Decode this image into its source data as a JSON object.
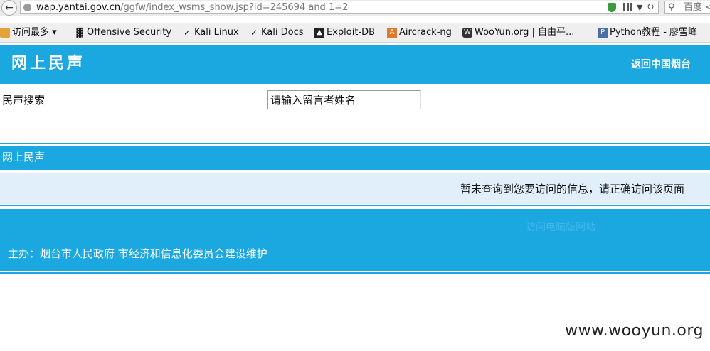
{
  "browser": {
    "url_host": "wap.yantai.gov.cn",
    "url_path": "/ggfw/index_wsms_show.jsp?id=245694 and 1=2",
    "search_placeholder": "百度 <",
    "bookmarks": [
      {
        "label": "访问最多",
        "icon": "folder-icon"
      },
      {
        "label": "Offensive Security",
        "icon": "dragon-icon"
      },
      {
        "label": "Kali Linux",
        "icon": "kali-icon"
      },
      {
        "label": "Kali Docs",
        "icon": "kali-icon"
      },
      {
        "label": "Exploit-DB",
        "icon": "exploit-db-icon"
      },
      {
        "label": "Aircrack-ng",
        "icon": "aircrack-icon"
      },
      {
        "label": "WooYun.org | 自由平...",
        "icon": "wooyun-icon"
      },
      {
        "label": "Python教程 - 廖雪峰",
        "icon": "python-icon"
      }
    ]
  },
  "header": {
    "title": "网上民声",
    "return_label": "返回中国烟台"
  },
  "search": {
    "label": "民声搜索",
    "input_value": "请输入留言者姓名"
  },
  "section": {
    "title": "网上民声"
  },
  "message": {
    "text": "暂未查询到您要访问的信息，请正确访问该页面"
  },
  "footer": {
    "desktop_link": "访问电脑版网站",
    "sponsor": "主办：烟台市人民政府  市经济和信息化委员会建设维护"
  },
  "watermark": "www.wooyun.org",
  "colors": {
    "brand_blue": "#1ba7e0",
    "message_bg": "#e0eff9"
  }
}
